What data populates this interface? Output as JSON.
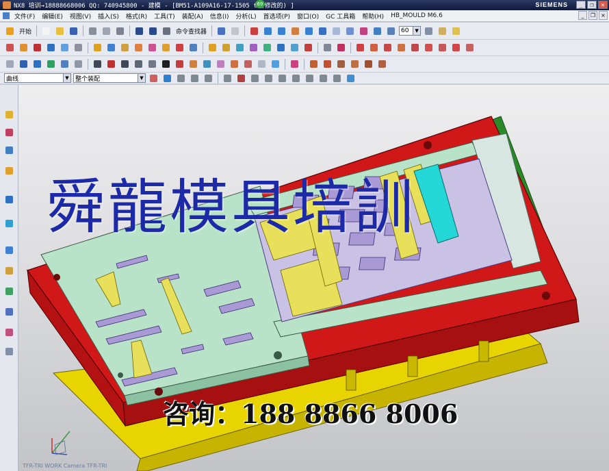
{
  "window": {
    "title": "NX8 培训→18888668006 QQ: 740945800 - 建模 - [BM51-A109A16-17-1505      t  (修改的) ]",
    "brand": "SIEMENS",
    "notification": "69",
    "controls": {
      "minimize": "_",
      "restore": "❐",
      "close": "×"
    }
  },
  "menu": {
    "items": [
      "文件(F)",
      "编辑(E)",
      "视图(V)",
      "插入(S)",
      "格式(R)",
      "工具(T)",
      "装配(A)",
      "信息(I)",
      "分析(L)",
      "首选项(P)",
      "窗口(O)",
      "GC 工具箱",
      "帮助(H)",
      "HB_MOULD M6.6"
    ]
  },
  "toolbar": {
    "start_label": "开始",
    "command_finder_label": "命令查找器",
    "zoom_value": "60"
  },
  "selection_bar": {
    "filter_value": "曲线",
    "scope_value": "整个装配"
  },
  "icons": {
    "toolbar_row1": [
      "new-file-icon",
      "open-folder-icon",
      "save-icon",
      "cut-icon",
      "copy-icon",
      "paste-icon",
      "undo-icon",
      "redo-icon",
      "command-finder-icon",
      "fit-icon",
      "zoom-icon",
      "rotate-icon",
      "pan-icon",
      "shaded-icon",
      "wireframe-icon",
      "view-orient-icon",
      "layer-icon",
      "measure-icon"
    ],
    "toolbar_row2": [
      "mold-wizard-icon",
      "part-family-icon",
      "layout-icon",
      "workpiece-icon",
      "cavity-layout-icon",
      "mold-base-icon",
      "standard-part-icon",
      "ejector-pin-icon",
      "slider-icon",
      "lifter-icon",
      "gate-icon",
      "runner-icon",
      "cooling-icon",
      "electrode-icon",
      "pocket-icon",
      "bom-icon",
      "drawing-icon",
      "tube-icon",
      "insert-icon",
      "view-manager-icon"
    ],
    "toolbar_row3": [
      "sketch-icon",
      "extrude-icon",
      "revolve-icon",
      "hole-icon",
      "boss-icon",
      "line-icon",
      "arc-icon",
      "rectangle-icon",
      "spline-icon",
      "text-icon",
      "trim-icon",
      "offset-icon",
      "mirror-icon",
      "pattern-icon",
      "blend-icon",
      "chamfer-icon",
      "sync-modeling-icon"
    ],
    "resource_bar": [
      "assembly-navigator-icon",
      "constraint-navigator-icon",
      "part-navigator-icon",
      "reuse-library-icon",
      "hd3d-tools-icon",
      "web-browser-icon",
      "history-icon",
      "system-materials-icon",
      "process-studio-icon",
      "manufacturing-wizard-icon",
      "roles-icon",
      "system-scenes-icon"
    ]
  },
  "graphics": {
    "watermark": "舜龍模具培訓",
    "contact": "咨询：188 8866 8006",
    "view_label": "TFR-TRI WORK Camera TFR-TRI"
  },
  "colors": {
    "plate_red": "#d01818",
    "plate_yellow": "#e8d400",
    "stripper_green": "#b9e3c8",
    "insert_purple": "#a99ad6",
    "watermark_blue": "#1d2aa8",
    "cyan_block": "#24d8d8"
  }
}
